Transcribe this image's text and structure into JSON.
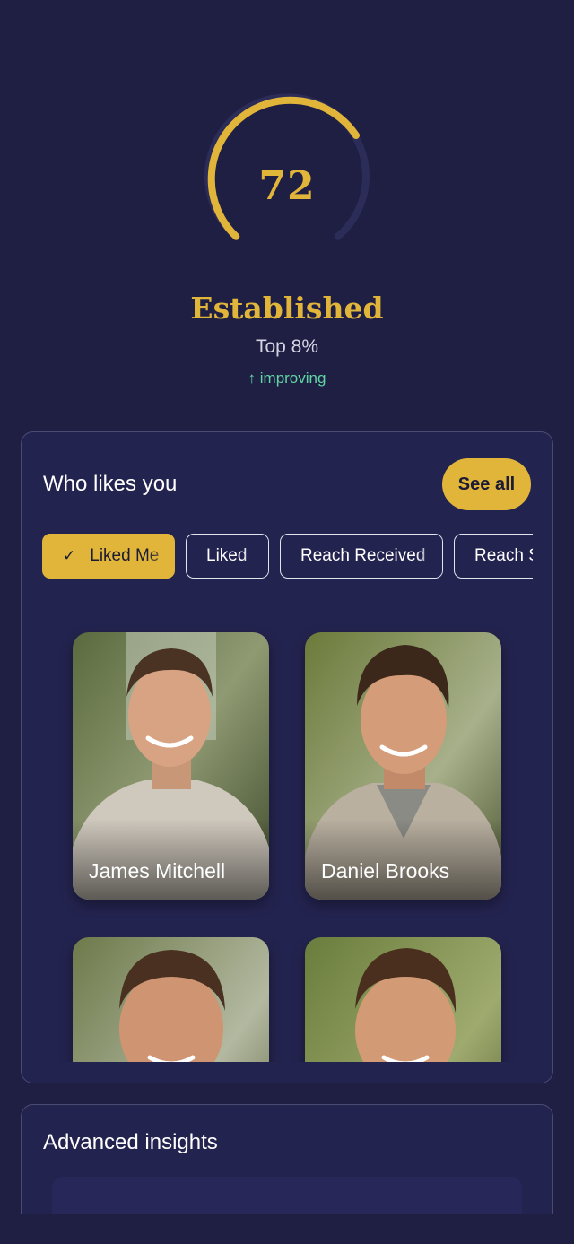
{
  "score": {
    "value": 72,
    "progress_fraction": 0.68,
    "tier": "Established",
    "rank": "Top 8%",
    "trend": "↑ improving",
    "accent_color": "#e0b53a",
    "trend_color": "#5fd6a4"
  },
  "likes": {
    "title": "Who likes you",
    "see_all_label": "See all",
    "chips": [
      {
        "label": "Liked Me",
        "icon": "check-icon",
        "active": true
      },
      {
        "label": "Liked",
        "active": false
      },
      {
        "label": "Reach Received",
        "active": false
      },
      {
        "label": "Reach Sent",
        "active": false
      }
    ],
    "profiles": [
      {
        "name": "James Mitchell"
      },
      {
        "name": "Daniel Brooks"
      },
      {
        "name": ""
      },
      {
        "name": ""
      }
    ]
  },
  "insights": {
    "title": "Advanced insights"
  },
  "colors": {
    "background": "#1f1f44",
    "card": "#23234f",
    "accent": "#e0b53a"
  }
}
